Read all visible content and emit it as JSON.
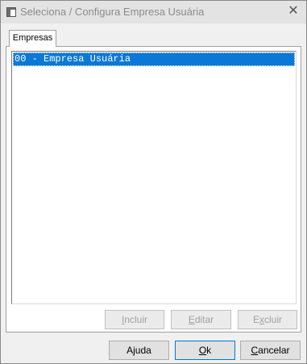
{
  "window": {
    "title": "Seleciona / Configura Empresa Usuária",
    "close_glyph": "✕"
  },
  "tabs": [
    {
      "label": "Empresas",
      "selected": true
    }
  ],
  "list": {
    "items": [
      {
        "text": "00 - Empresa Usuária",
        "selected": true
      }
    ]
  },
  "panel_buttons": {
    "incluir": {
      "accel": "I",
      "rest": "ncluir",
      "enabled": false
    },
    "editar": {
      "accel": "E",
      "rest": "ditar",
      "enabled": false
    },
    "excluir": {
      "pre": "E",
      "accel": "x",
      "rest": "cluir",
      "enabled": false
    }
  },
  "dialog_buttons": {
    "ajuda": {
      "label": "Ajuda"
    },
    "ok": {
      "accel": "O",
      "rest": "k"
    },
    "cancelar": {
      "accel": "C",
      "rest": "ancelar"
    }
  },
  "colors": {
    "selection": "#0a78d7",
    "window_bg": "#f0f0f0",
    "disabled_text": "#a0a0a0"
  },
  "icons": {
    "app": "window-app-icon",
    "close": "close-icon"
  }
}
